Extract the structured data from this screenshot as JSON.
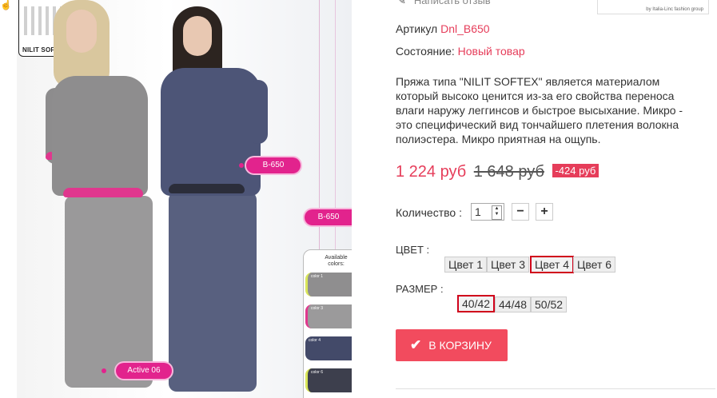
{
  "photo": {
    "cert_label": "NILIT SOFTEX®",
    "available_colors": "Available colors:",
    "swatches": [
      "color 1",
      "color 3",
      "color 4",
      "color 6"
    ],
    "tag_b650_a": "B-650",
    "tag_b650_b": "B-650",
    "tag_active": "Active 06"
  },
  "review_link": "Написать отзыв",
  "brand_logo_text": "by Italia-Linc fashion group",
  "sku": {
    "label": "Артикул",
    "value": "Dnl_B650"
  },
  "condition": {
    "label": "Состояние:",
    "value": "Новый товар"
  },
  "description": "Пряжа типа \"NILIT SOFTEX\" является материалом который высоко ценится из-за его свойства переноса влаги наружу леггинсов и быстрое высыхание. Микро - это специфический вид тончайшего плетения волокна полиэстера. Микро приятная на ощупь.",
  "price": {
    "current": "1 224 руб",
    "old": "1 648 руб",
    "discount": "-424 руб"
  },
  "quantity": {
    "label": "Количество :",
    "value": "1"
  },
  "color": {
    "label": "ЦВЕТ :",
    "options": [
      "Цвет 1",
      "Цвет 3",
      "Цвет 4",
      "Цвет 6"
    ],
    "selected": "Цвет 4"
  },
  "size": {
    "label": "РАЗМЕР :",
    "options": [
      "40/42",
      "44/48",
      "50/52"
    ],
    "selected": "40/42"
  },
  "cart_button": "В КОРЗИНУ",
  "colors": {
    "accent": "#e63d5a",
    "button": "#f24b5e",
    "selected_border": "#d0021b",
    "tag_pink": "#e2238d"
  }
}
